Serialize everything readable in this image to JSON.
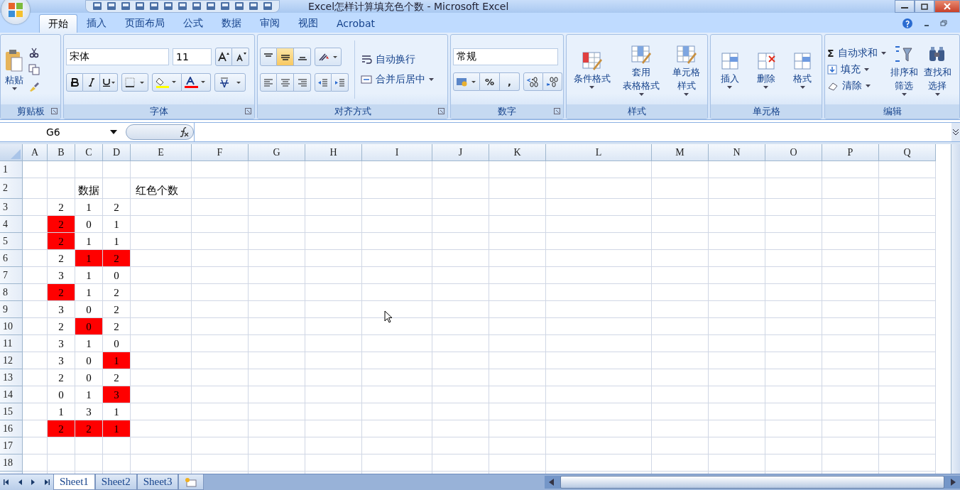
{
  "window": {
    "title": "Excel怎样计算填充色个数 - Microsoft Excel"
  },
  "ribbon_tabs": [
    {
      "label": "开始",
      "selected": true
    },
    {
      "label": "插入",
      "selected": false
    },
    {
      "label": "页面布局",
      "selected": false
    },
    {
      "label": "公式",
      "selected": false
    },
    {
      "label": "数据",
      "selected": false
    },
    {
      "label": "审阅",
      "selected": false
    },
    {
      "label": "视图",
      "selected": false
    },
    {
      "label": "Acrobat",
      "selected": false
    }
  ],
  "clipboard": {
    "label": "剪贴板",
    "paste": "粘贴"
  },
  "font": {
    "label": "字体",
    "name": "宋体",
    "size": "11"
  },
  "alignment": {
    "label": "对齐方式",
    "wrap": "自动换行",
    "merge": "合并后居中"
  },
  "number": {
    "label": "数字",
    "format": "常规",
    "percent": "%",
    "comma": ","
  },
  "styles": {
    "label": "样式",
    "buttons": [
      {
        "lines": [
          "条件格式"
        ]
      },
      {
        "lines": [
          "套用",
          "表格格式"
        ]
      },
      {
        "lines": [
          "单元格",
          "样式"
        ]
      }
    ]
  },
  "cells": {
    "label": "单元格",
    "buttons": [
      "插入",
      "删除",
      "格式"
    ]
  },
  "editing": {
    "label": "编辑",
    "sigma": "Σ",
    "items": [
      "自动求和",
      "填充",
      "清除"
    ],
    "buttons": [
      {
        "lines": [
          "排序和",
          "筛选"
        ]
      },
      {
        "lines": [
          "查找和",
          "选择"
        ]
      }
    ]
  },
  "formula_bar": {
    "name_box": "G6"
  },
  "columns": [
    "A",
    "B",
    "C",
    "D",
    "E",
    "F",
    "G",
    "H",
    "I",
    "J",
    "K",
    "L",
    "M",
    "N",
    "O",
    "P",
    "Q"
  ],
  "title_row": {
    "label": "2",
    "data_label": "数据",
    "count_label": "红色个数"
  },
  "data_rows": [
    {
      "label": "3",
      "cells": [
        {
          "value": "2",
          "filled": false
        },
        {
          "value": "1",
          "filled": false
        },
        {
          "value": "2",
          "filled": false
        }
      ]
    },
    {
      "label": "4",
      "cells": [
        {
          "value": "2",
          "filled": true
        },
        {
          "value": "0",
          "filled": false
        },
        {
          "value": "1",
          "filled": false
        }
      ]
    },
    {
      "label": "5",
      "cells": [
        {
          "value": "2",
          "filled": true
        },
        {
          "value": "1",
          "filled": false
        },
        {
          "value": "1",
          "filled": false
        }
      ]
    },
    {
      "label": "6",
      "cells": [
        {
          "value": "2",
          "filled": false
        },
        {
          "value": "1",
          "filled": true
        },
        {
          "value": "2",
          "filled": true
        }
      ]
    },
    {
      "label": "7",
      "cells": [
        {
          "value": "3",
          "filled": false
        },
        {
          "value": "1",
          "filled": false
        },
        {
          "value": "0",
          "filled": false
        }
      ]
    },
    {
      "label": "8",
      "cells": [
        {
          "value": "2",
          "filled": true
        },
        {
          "value": "1",
          "filled": false
        },
        {
          "value": "2",
          "filled": false
        }
      ]
    },
    {
      "label": "9",
      "cells": [
        {
          "value": "3",
          "filled": false
        },
        {
          "value": "0",
          "filled": false
        },
        {
          "value": "2",
          "filled": false
        }
      ]
    },
    {
      "label": "10",
      "cells": [
        {
          "value": "2",
          "filled": false
        },
        {
          "value": "0",
          "filled": true
        },
        {
          "value": "2",
          "filled": false
        }
      ]
    },
    {
      "label": "11",
      "cells": [
        {
          "value": "3",
          "filled": false
        },
        {
          "value": "1",
          "filled": false
        },
        {
          "value": "0",
          "filled": false
        }
      ]
    },
    {
      "label": "12",
      "cells": [
        {
          "value": "3",
          "filled": false
        },
        {
          "value": "0",
          "filled": false
        },
        {
          "value": "1",
          "filled": true
        }
      ]
    },
    {
      "label": "13",
      "cells": [
        {
          "value": "2",
          "filled": false
        },
        {
          "value": "0",
          "filled": false
        },
        {
          "value": "2",
          "filled": false
        }
      ]
    },
    {
      "label": "14",
      "cells": [
        {
          "value": "0",
          "filled": false
        },
        {
          "value": "1",
          "filled": false
        },
        {
          "value": "3",
          "filled": true
        }
      ]
    },
    {
      "label": "15",
      "cells": [
        {
          "value": "1",
          "filled": false
        },
        {
          "value": "3",
          "filled": false
        },
        {
          "value": "1",
          "filled": false
        }
      ]
    },
    {
      "label": "16",
      "cells": [
        {
          "value": "2",
          "filled": true
        },
        {
          "value": "2",
          "filled": true
        },
        {
          "value": "1",
          "filled": true
        }
      ]
    }
  ],
  "first_row": {
    "label": "1"
  },
  "end_rows": [
    "17",
    "18"
  ],
  "sheet_tabs": [
    {
      "label": "Sheet1",
      "selected": true
    },
    {
      "label": "Sheet2",
      "selected": false
    },
    {
      "label": "Sheet3",
      "selected": false
    }
  ]
}
